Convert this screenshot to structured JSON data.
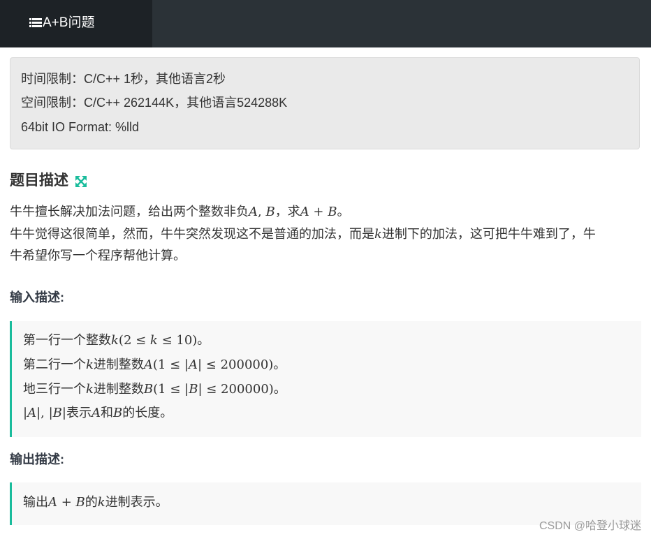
{
  "header": {
    "tab_title": "A+B问题",
    "icon": "list-icon"
  },
  "limits": {
    "time": "时间限制：C/C++ 1秒，其他语言2秒",
    "space": "空间限制：C/C++ 262144K，其他语言524288K",
    "io_format": "64bit IO Format: %lld"
  },
  "description": {
    "title": "题目描述",
    "expand_icon": "expand-icon",
    "line1_prefix": "牛牛擅长解决加法问题，给出两个整数非负",
    "line1_math1": "A",
    "line1_sep": ", ",
    "line1_math2": "B",
    "line1_mid": "，求",
    "line1_math3": "A",
    "line1_plus": " + ",
    "line1_math4": "B",
    "line1_end": "。",
    "line2_a": "牛牛觉得这很简单，然而，牛牛突然发现这不是普通的加法，而是",
    "line2_k": "k",
    "line2_b": "进制下的加法，这可把牛牛难到了，牛",
    "line3": "牛希望你写一个程序帮他计算。"
  },
  "input": {
    "title": "输入描述:",
    "l1_a": "第一行一个整数",
    "l1_k": "k",
    "l1_b": "(2 ≤ ",
    "l1_k2": "k",
    "l1_c": " ≤ 10)。",
    "l2_a": "第二行一个",
    "l2_k": "k",
    "l2_b": "进制整数",
    "l2_A": "A",
    "l2_c": "(1 ≤ |",
    "l2_A2": "A",
    "l2_d": "| ≤ 200000)。",
    "l3_a": "地三行一个",
    "l3_k": "k",
    "l3_b": "进制整数",
    "l3_B": "B",
    "l3_c": "(1 ≤ |",
    "l3_B2": "B",
    "l3_d": "| ≤ 200000)。",
    "l4_a": "|",
    "l4_A": "A",
    "l4_b": "|, |",
    "l4_B": "B",
    "l4_c": "|表示",
    "l4_A2": "A",
    "l4_d": "和",
    "l4_B2": "B",
    "l4_e": "的长度。"
  },
  "output": {
    "title": "输出描述:",
    "a": "输出",
    "A": "A",
    "plus": " + ",
    "B": "B",
    "b": "的",
    "k": "k",
    "c": "进制表示。"
  },
  "watermark": "CSDN @哈登小球迷",
  "colors": {
    "topbar": "#2b3237",
    "active_tab": "#1d2226",
    "accent": "#1abc9c",
    "limits_bg": "#eaeaea",
    "quote_bg": "#f8f8f8"
  }
}
